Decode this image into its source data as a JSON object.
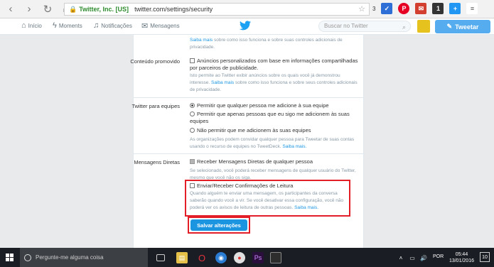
{
  "browser": {
    "back": "‹",
    "forward": "›",
    "reload": "↻",
    "home": "⌂",
    "secure_label": "Twitter, Inc. [US]",
    "url": "twitter.com/settings/security",
    "ext_count": "3",
    "ext_badge": "1"
  },
  "nav": {
    "home": "Início",
    "moments": "Moments",
    "notifications": "Notificações",
    "messages": "Mensagens",
    "search_placeholder": "Buscar no Twitter",
    "tweet_button": "Tweetar"
  },
  "settings": {
    "top_help_link": "Saiba mais",
    "top_help_text": " sobre como isso funciona e sobre suas controles adicionais de privacidade.",
    "promoted_label": "Conteúdo promovido",
    "promoted_option": "Anúncios personalizados com base em informações compartilhadas por parceiros de publicidade.",
    "promoted_help": "Isto permite ao Twitter exibir anúncios sobre os quais você já demonstrou interesse. ",
    "promoted_help_link": "Saiba mais",
    "promoted_help_tail": " sobre como isso funciona e sobre seus controles adicionais de privacidade.",
    "teams_label": "Twitter para equipes",
    "teams_opt1": "Permitir que qualquer pessoa me adicione à sua equipe",
    "teams_opt2": "Permitir que apenas pessoas que eu sigo me adicionem às suas equipes",
    "teams_opt3": "Não permitir que me adicionem às suas equipes",
    "teams_help": "As organizações podem convidar qualquer pessoa para Tweetar de suas contas usando o recurso de equipes no TweetDeck. ",
    "teams_help_link": "Saiba mais.",
    "dm_label": "Mensagens Diretas",
    "dm_option": "Receber Mensagens Diretas de qualquer pessoa",
    "dm_help": "Se selecionado, você poderá receber mensagens de qualquer usuário do Twitter, mesmo que você não os siga.",
    "receipts_option": "Enviar/Receber Confirmações de Leitura",
    "receipts_help": "Quando alguém te enviar uma mensagem, os participantes da conversa saberão quando você a vir. Se você desativar essa configuração, você não poderá ver os avisos de leitura de outras pessoas. ",
    "receipts_help_link": "Saiba mais.",
    "save_button": "Salvar alterações"
  },
  "taskbar": {
    "search_placeholder": "Pergunte-me alguma coisa",
    "lang": "POR",
    "time": "05:44",
    "date": "13/01/2016",
    "notif_count": "10"
  },
  "colors": {
    "accent": "#1b95e0",
    "highlight": "#e41e26"
  }
}
